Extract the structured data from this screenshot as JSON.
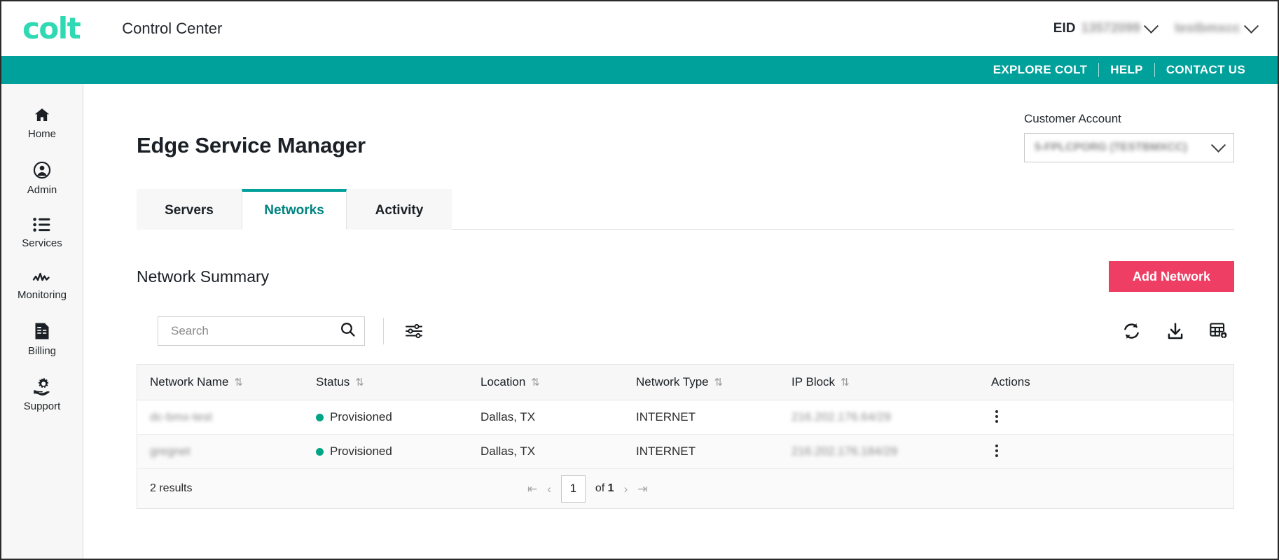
{
  "header": {
    "logo_text": "colt",
    "app_title": "Control Center",
    "eid_label": "EID",
    "eid_value": "13572099",
    "user_name": "testbmxcc",
    "nav_links": [
      "EXPLORE COLT",
      "HELP",
      "CONTACT US"
    ]
  },
  "sidebar": {
    "items": [
      {
        "label": "Home",
        "icon": "home-icon"
      },
      {
        "label": "Admin",
        "icon": "user-circle-icon"
      },
      {
        "label": "Services",
        "icon": "list-icon"
      },
      {
        "label": "Monitoring",
        "icon": "activity-icon"
      },
      {
        "label": "Billing",
        "icon": "invoice-icon"
      },
      {
        "label": "Support",
        "icon": "support-gear-icon"
      }
    ]
  },
  "page": {
    "title": "Edge Service Manager",
    "account_label": "Customer Account",
    "account_value": "5-FPLCPORG (TESTBMXCC)"
  },
  "tabs": [
    {
      "label": "Servers",
      "active": false
    },
    {
      "label": "Networks",
      "active": true
    },
    {
      "label": "Activity",
      "active": false
    }
  ],
  "summary": {
    "title": "Network Summary",
    "add_button": "Add Network"
  },
  "toolbar": {
    "search_placeholder": "Search",
    "search_value": "",
    "icons": [
      "search-icon",
      "filter-sliders-icon",
      "refresh-icon",
      "download-icon",
      "table-settings-icon"
    ]
  },
  "table": {
    "columns": [
      {
        "label": "Network Name",
        "sortable": true
      },
      {
        "label": "Status",
        "sortable": true
      },
      {
        "label": "Location",
        "sortable": true
      },
      {
        "label": "Network Type",
        "sortable": true
      },
      {
        "label": "IP Block",
        "sortable": true
      },
      {
        "label": "Actions",
        "sortable": false
      }
    ],
    "rows": [
      {
        "network_name": "dc-bmx-test",
        "status": "Provisioned",
        "location": "Dallas, TX",
        "network_type": "INTERNET",
        "ip_block": "216.202.176.64/29"
      },
      {
        "network_name": "gregnet",
        "status": "Provisioned",
        "location": "Dallas, TX",
        "network_type": "INTERNET",
        "ip_block": "216.202.176.184/29"
      }
    ]
  },
  "footer": {
    "results_text": "2 results",
    "page_value": "1",
    "of_label": "of",
    "total_pages": "1"
  },
  "colors": {
    "brand_teal": "#00a09b",
    "logo_green": "#2ed9b4",
    "accent_pink": "#ef3e64",
    "status_green": "#00a684",
    "tab_active_text": "#00837f"
  }
}
